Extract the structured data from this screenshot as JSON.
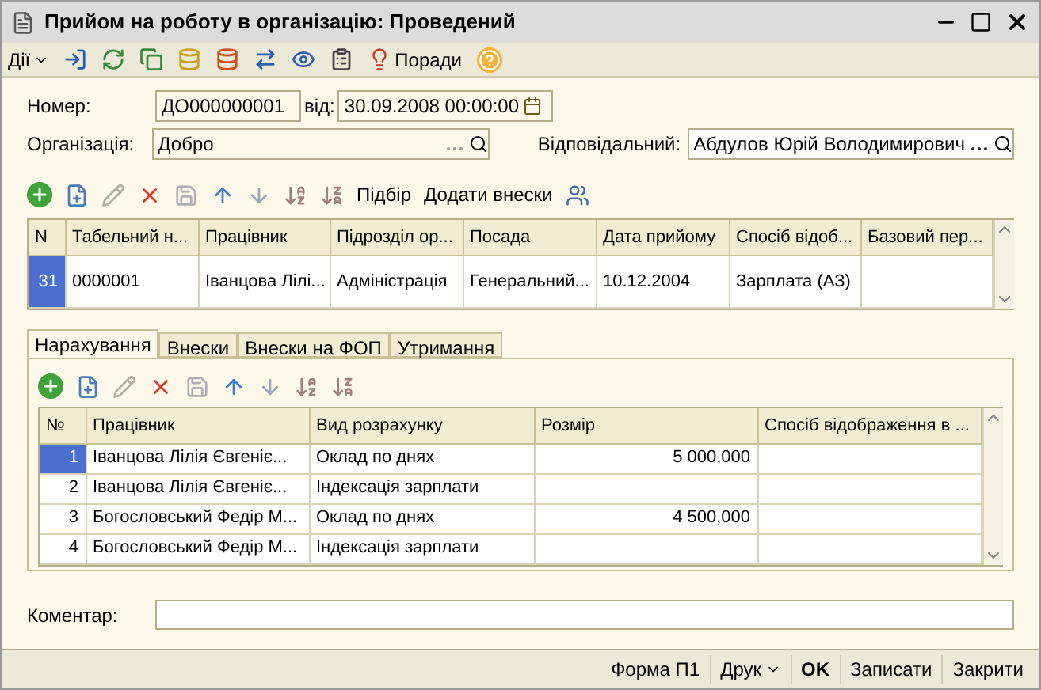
{
  "window": {
    "title": "Прийом на роботу в організацію: Проведений"
  },
  "toolbar": {
    "menu_label": "Дії",
    "tips_label": "Поради"
  },
  "header": {
    "number_label": "Номер:",
    "number": "ДО000000001",
    "date_label": "від:",
    "date": "30.09.2008 00:00:00",
    "organization_label": "Організація:",
    "organization": "Добро",
    "responsible_label": "Відповідальний:",
    "responsible": "Абдулов Юрій Володимирович"
  },
  "table_toolbar": {
    "pick_label": "Підбір",
    "add_label": "Додати внески"
  },
  "table": {
    "columns": [
      "N",
      "Табельний н...",
      "Працівник",
      "Підрозділ ор...",
      "Посада",
      "Дата прийому",
      "Спосіб відоб...",
      "Базовий пер..."
    ],
    "rows": [
      {
        "selected": true,
        "cells": [
          "31",
          "0000001",
          "Іванцова Лілі...",
          "Адміністрація",
          "Генеральний...",
          "10.12.2004",
          "Зарплата (АЗ)",
          ""
        ]
      }
    ]
  },
  "tabs": [
    {
      "label": "Нарахування",
      "selected": true
    },
    {
      "label": "Внески",
      "selected": false
    },
    {
      "label": "Внески на ФОП",
      "selected": false
    },
    {
      "label": "Утримання",
      "selected": false
    }
  ],
  "accruals": {
    "columns": [
      "№",
      "Працівник",
      "Вид розрахунку",
      "Розмір",
      "Спосіб відображення в ..."
    ],
    "rows": [
      {
        "selected": true,
        "cells": [
          "1",
          "Іванцова Лілія Євгеніє...",
          "Оклад по днях",
          "5 000,000",
          ""
        ]
      },
      {
        "selected": false,
        "cells": [
          "2",
          "Іванцова Лілія Євгеніє...",
          "Індексація зарплати",
          "",
          ""
        ]
      },
      {
        "selected": false,
        "cells": [
          "3",
          "Богословський Федір М...",
          "Оклад по днях",
          "4 500,000",
          ""
        ]
      },
      {
        "selected": false,
        "cells": [
          "4",
          "Богословський Федір М...",
          "Індексація зарплати",
          "",
          ""
        ]
      }
    ]
  },
  "comment": {
    "label": "Коментар:"
  },
  "buttons": [
    {
      "label": "Форма П1",
      "kind": "plain"
    },
    {
      "label": "Друк",
      "kind": "menu"
    },
    {
      "label": "OK",
      "kind": "default"
    },
    {
      "label": "Записати",
      "kind": "plain"
    },
    {
      "label": "Закрити",
      "kind": "plain"
    }
  ]
}
